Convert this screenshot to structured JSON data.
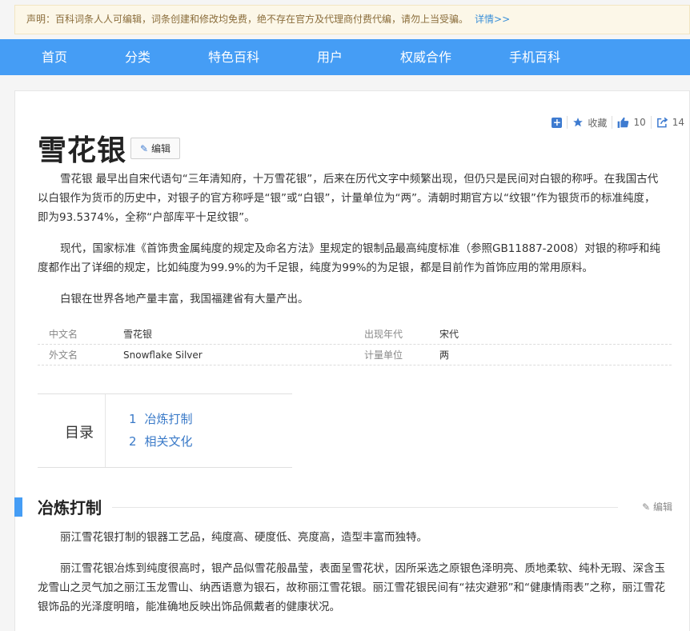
{
  "notice": {
    "text": "声明：百科词条人人可编辑，词条创建和修改均免费，绝不存在官方及代理商付费代编，请勿上当受骗。",
    "more": "详情>>"
  },
  "nav": [
    "首页",
    "分类",
    "特色百科",
    "用户",
    "权威合作",
    "手机百科"
  ],
  "tools": {
    "favorite_label": "收藏",
    "like_count": "10",
    "share_count": "14"
  },
  "entry": {
    "title": "雪花银",
    "edit_label": "编辑"
  },
  "intro": [
    "雪花银 最早出自宋代语句“三年清知府，十万雪花银”，后来在历代文字中频繁出现，但仍只是民间对白银的称呼。在我国古代以白银作为货币的历史中，对银子的官方称呼是“银”或“白银”，计量单位为“两”。清朝时期官方以“纹银”作为银货币的标准纯度，即为93.5374%，全称“户部库平十足纹银”。",
    "现代，国家标准《首饰贵金属纯度的规定及命名方法》里规定的银制品最高纯度标准（参照GB11887-2008）对银的称呼和纯度都作出了详细的规定，比如纯度为99.9%的为千足银，纯度为99%的为足银，都是目前作为首饰应用的常用原料。",
    "白银在世界各地产量丰富，我国福建省有大量产出。"
  ],
  "infobox": [
    {
      "k1": "中文名",
      "v1": "雪花银",
      "k2": "出现年代",
      "v2": "宋代"
    },
    {
      "k1": "外文名",
      "v1": "Snowflake Silver",
      "k2": "计量单位",
      "v2": "两"
    }
  ],
  "toc": {
    "label": "目录",
    "items": [
      {
        "num": "1",
        "text": "冶炼打制"
      },
      {
        "num": "2",
        "text": "相关文化"
      }
    ]
  },
  "section1": {
    "title": "冶炼打制",
    "edit_label": "编辑",
    "paragraphs": [
      "丽江雪花银打制的银器工艺品，纯度高、硬度低、亮度高，造型丰富而独特。",
      "丽江雪花银冶炼到纯度很高时，银产品似雪花般晶莹，表面呈雪花状，因所采选之原银色泽明亮、质地柔软、纯朴无瑕、深含玉龙雪山之灵气加之丽江玉龙雪山、纳西语意为银石，故称丽江雪花银。丽江雪花银民间有“祛灾避邪”和“健康情雨表”之称，丽江雪花银饰品的光泽度明暗，能准确地反映出饰品佩戴者的健康状况。"
    ]
  },
  "colors": {
    "nav_bg": "#459df5",
    "link": "#3a7ac8",
    "notice_bg": "#fcf7e8"
  }
}
